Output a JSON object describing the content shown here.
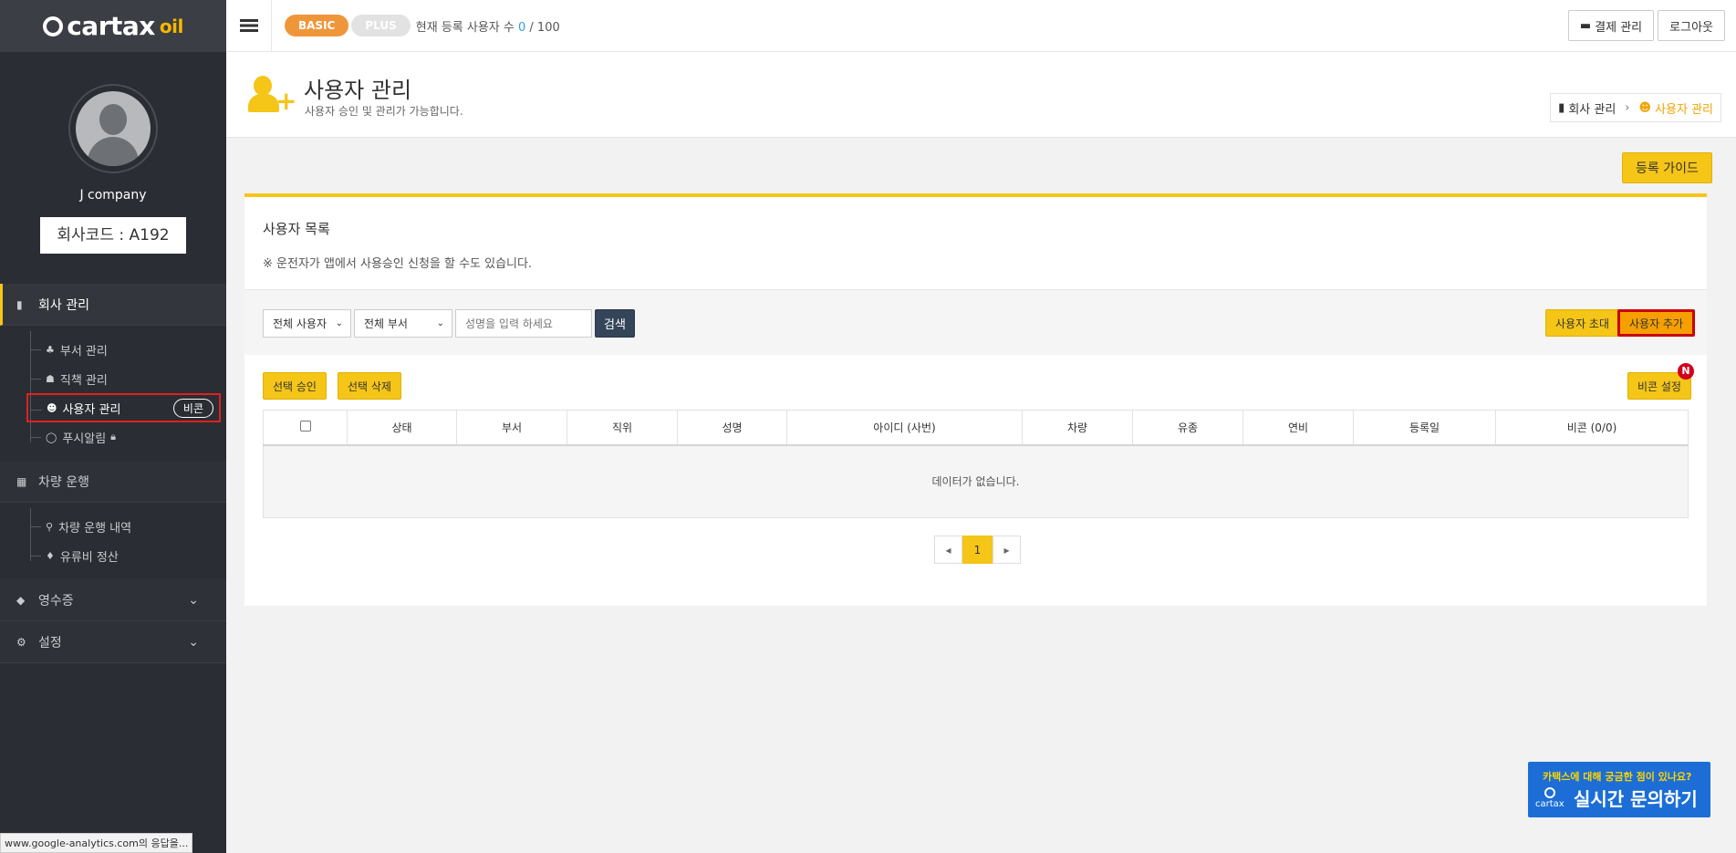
{
  "sidebar": {
    "logo_main": "cartax",
    "logo_suffix": "oil",
    "company_name": "J company",
    "company_code": "회사코드 : A192",
    "menu": {
      "company": "회사 관리",
      "dept": "부서 관리",
      "position": "직책 관리",
      "users": "사용자 관리",
      "beacon_pill": "비콘",
      "push": "푸시알림",
      "vehicle": "차량 운행",
      "drive_log": "차량 운행 내역",
      "fuel": "유류비 정산",
      "receipt": "영수증",
      "settings": "설정"
    },
    "status_url": "www.google-analytics.com의 응답을..."
  },
  "topbar": {
    "basic": "BASIC",
    "plus": "PLUS",
    "user_count_label": "현재 등록 사용자 수",
    "user_count_current": "0",
    "user_count_max": "/ 100",
    "payment": "결제 관리",
    "logout": "로그아웃"
  },
  "header": {
    "title": "사용자 관리",
    "subtitle": "사용자 승인 및 관리가 가능합니다.",
    "breadcrumb_root": "회사 관리",
    "breadcrumb_current": "사용자 관리"
  },
  "main": {
    "guide_button": "등록 가이드",
    "list_title": "사용자 목록",
    "note": "※ 운전자가 앱에서 사용승인 신청을 할 수도 있습니다.",
    "filter_user": "전체 사용자",
    "filter_dept": "전체 부서",
    "search_placeholder": "성명을 입력 하세요",
    "search_button": "검색",
    "invite_button": "사용자 초대",
    "add_button": "사용자 추가",
    "approve_button": "선택 승인",
    "delete_button": "선택 삭제",
    "beacon_button": "비콘 설정",
    "beacon_badge": "N",
    "columns": [
      "상태",
      "부서",
      "직위",
      "성명",
      "아이디 (사번)",
      "차량",
      "유종",
      "연비",
      "등록일",
      "비콘 (0/0)"
    ],
    "empty_text": "데이터가 없습니다.",
    "page": "1"
  },
  "chat": {
    "top": "카택스에 대해 궁금한 점이 있나요?",
    "main": "실시간 문의하기",
    "logo": "cartax"
  },
  "colors": {
    "accent": "#f5c518",
    "sidebar": "#2a2d33",
    "chat": "#1c6ed6"
  }
}
